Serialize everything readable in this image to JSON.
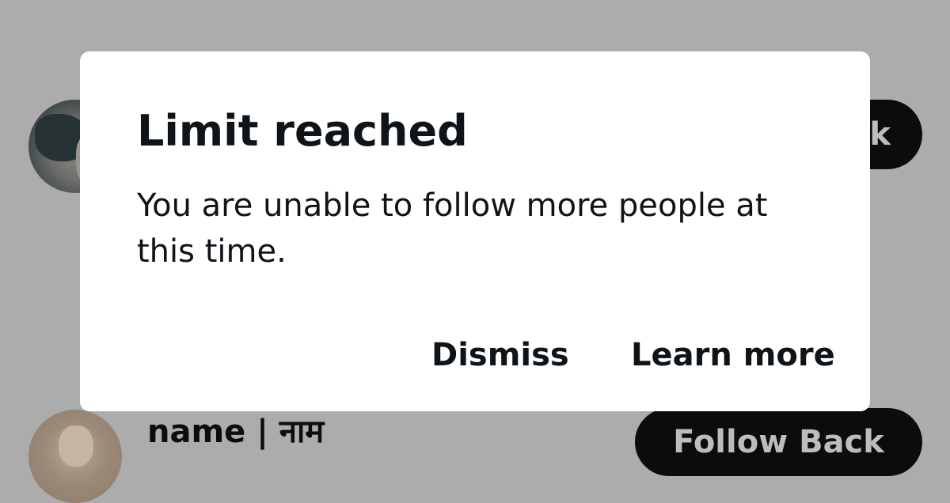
{
  "background": {
    "rows": [
      {
        "follow_button_label": "k"
      },
      {
        "display_name": "name | नाम",
        "follow_button_label": "Follow Back"
      }
    ]
  },
  "dialog": {
    "title": "Limit reached",
    "message": "You are unable to follow more people at this time.",
    "dismiss_label": "Dismiss",
    "learn_more_label": "Learn more"
  },
  "colors": {
    "overlay": "#acacac",
    "dialog_background": "#ffffff",
    "text": "#0f1419",
    "pill_background": "#0c0c0c"
  }
}
